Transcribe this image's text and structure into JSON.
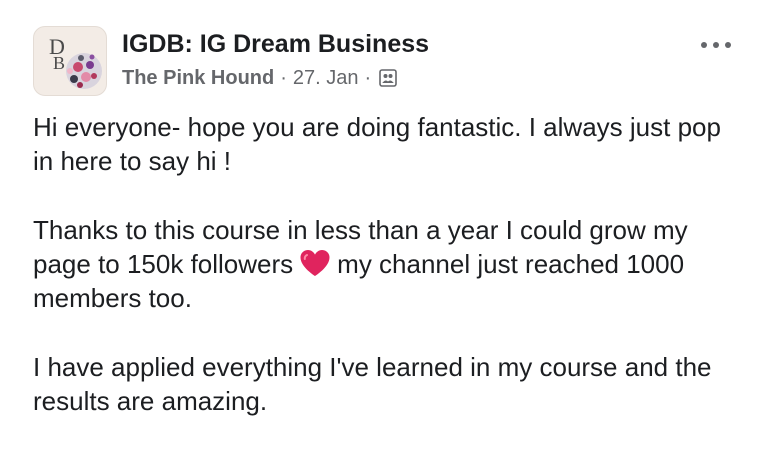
{
  "post": {
    "group_name": "IGDB: IG Dream Business",
    "author": "The Pink Hound",
    "date": "27. Jan",
    "separator": "·",
    "audience_icon": "members-icon",
    "more_icon": "more-options-icon",
    "avatar_monogram": "D",
    "avatar_monogram_2": "B",
    "paragraphs": {
      "p1": "Hi everyone- hope you are doing fantastic. I always just pop in here to say hi !",
      "p2_before": "Thanks to this course in less than a year I could grow my page to 150k followers",
      "p2_emoji": "heart-emoji",
      "p2_after": "my channel just reached 1000 members too.",
      "p3": "I have applied everything I've learned in my course and the results are amazing."
    }
  },
  "colors": {
    "text": "#1c1e21",
    "secondary": "#65676b",
    "heart": "#e0245e"
  }
}
